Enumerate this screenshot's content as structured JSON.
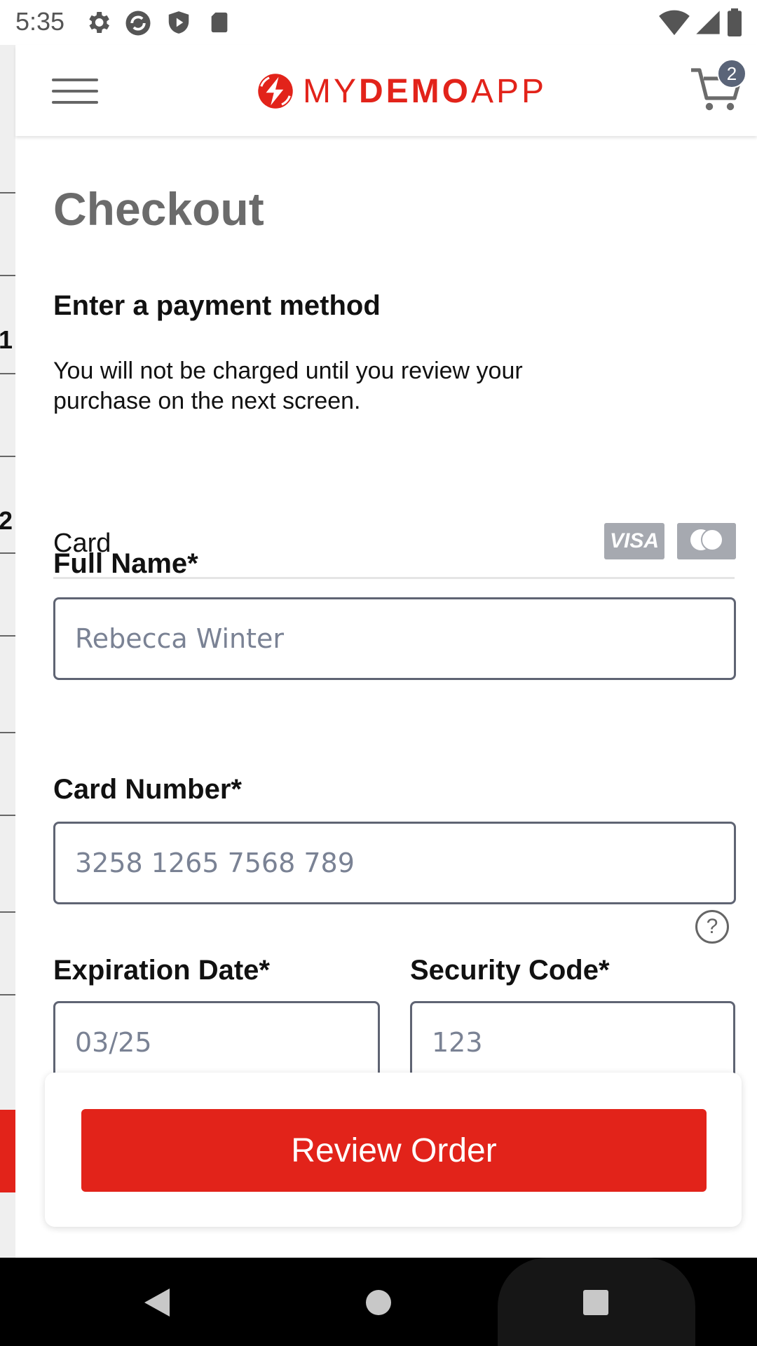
{
  "status_bar": {
    "time": "5:35",
    "icons": [
      "settings-icon",
      "sync-icon",
      "shield-play-icon",
      "sd-card-icon",
      "wifi-icon",
      "signal-icon",
      "battery-icon"
    ]
  },
  "background_screen": {
    "partial_chars": [
      "1",
      "2"
    ]
  },
  "header": {
    "logo_light_1": "MY",
    "logo_bold": "DEMO",
    "logo_light_2": "APP",
    "cart_count": "2"
  },
  "checkout": {
    "title": "Checkout",
    "section_title": "Enter a payment method",
    "description": "You will not be charged until you review your purchase on the next screen.",
    "card_label": "Card",
    "visa_label": "VISA"
  },
  "form": {
    "full_name": {
      "label": "Full Name*",
      "placeholder": "Rebecca Winter"
    },
    "card_number": {
      "label": "Card Number*",
      "placeholder": "3258 1265 7568 789"
    },
    "expiration": {
      "label": "Expiration Date*",
      "placeholder": "03/25"
    },
    "security": {
      "label": "Security Code*",
      "placeholder": "123",
      "help_glyph": "?"
    }
  },
  "footer": {
    "review_button": "Review Order"
  },
  "colors": {
    "brand_red": "#e2231a",
    "badge": "#5a6478",
    "input_border": "#5f6473"
  }
}
